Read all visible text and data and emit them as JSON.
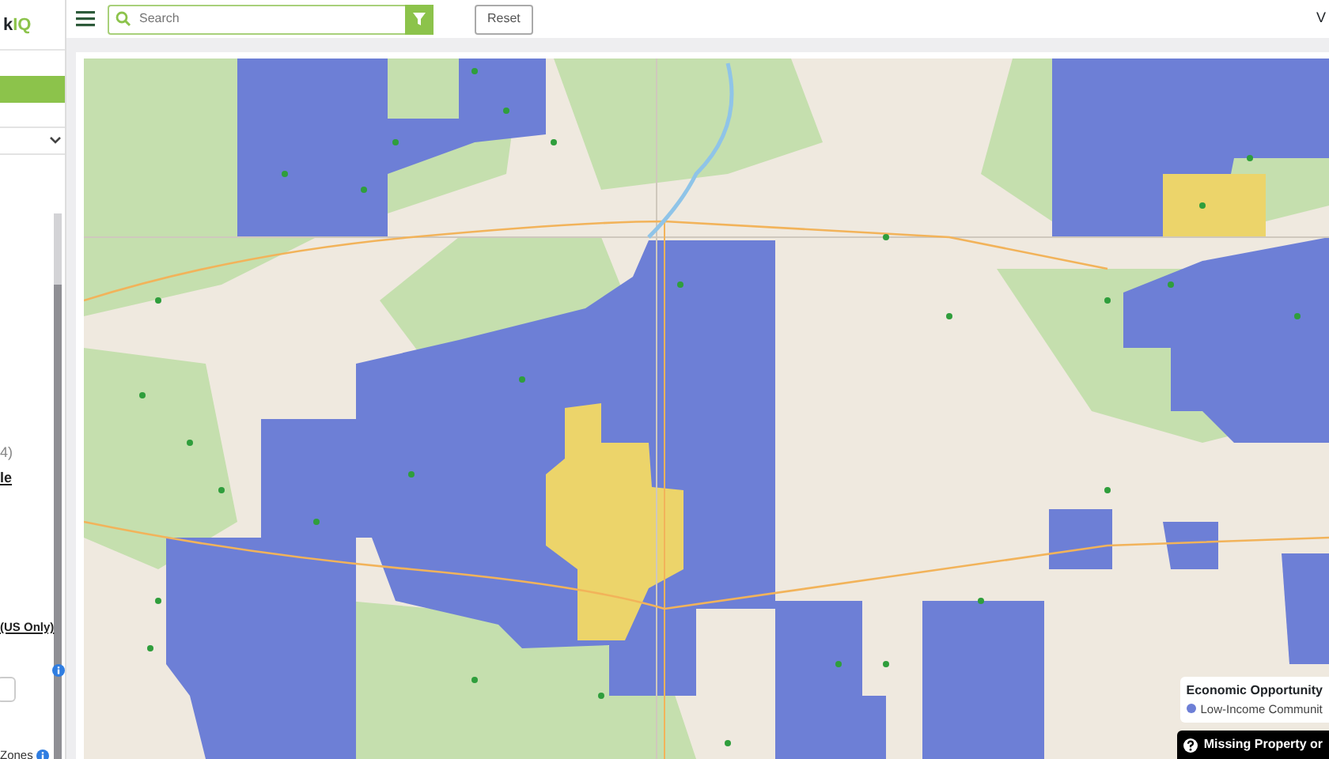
{
  "sidebar": {
    "logo": {
      "dark": "k",
      "accent": "IQ"
    },
    "text_1": "4)",
    "link_1": "le",
    "link_2": "(US Only)",
    "zones_label": "Zones"
  },
  "toolbar": {
    "search": {
      "placeholder": "Search"
    },
    "reset": "Reset",
    "corner_text": "V"
  },
  "map": {
    "legend": {
      "title": "Economic Opportunity",
      "items": [
        {
          "label": "Low-Income Communit",
          "color": "#6d7fd6"
        }
      ]
    },
    "missing_button": "Missing Property or"
  }
}
